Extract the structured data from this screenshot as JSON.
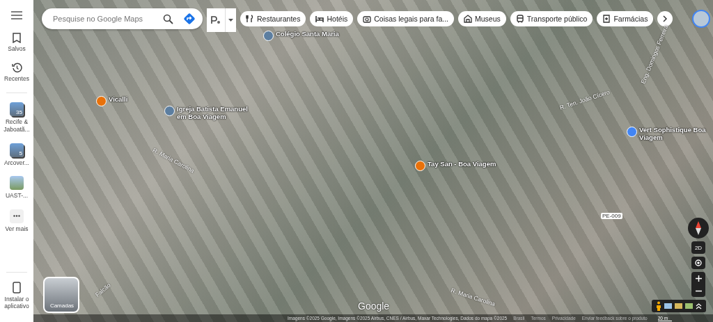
{
  "sidebar": {
    "items": [
      {
        "kind": "saved",
        "label": "Salvos"
      },
      {
        "kind": "recent",
        "label": "Recentes"
      },
      {
        "kind": "list",
        "label": "Recife & Jaboatã...",
        "count": "35"
      },
      {
        "kind": "list",
        "label": "Arcover...",
        "count": "5"
      },
      {
        "kind": "place",
        "label": "UAST-..."
      },
      {
        "kind": "more",
        "label": "Ver mais"
      }
    ],
    "install": "Instalar o aplicativo"
  },
  "search": {
    "placeholder": "Pesquise no Google Maps"
  },
  "chips": [
    {
      "kind": "restaurant",
      "label": "Restaurantes"
    },
    {
      "kind": "hotel",
      "label": "Hotéis"
    },
    {
      "kind": "camera",
      "label": "Coisas legais para fa..."
    },
    {
      "kind": "museum",
      "label": "Museus"
    },
    {
      "kind": "transit",
      "label": "Transporte público"
    },
    {
      "kind": "pharmacy",
      "label": "Farmácias"
    }
  ],
  "map_labels": [
    {
      "kind": "school",
      "text": "Colégio Santa Maria"
    },
    {
      "kind": "restaurant",
      "text": "Vicalli"
    },
    {
      "kind": "church",
      "text": "Igreja Batista Emanuel em Boa Viagem"
    },
    {
      "kind": "restaurant",
      "text": "Tay San - Boa Viagem"
    },
    {
      "kind": "shop",
      "text": "Vert Sophistique Boa Viagem"
    },
    {
      "kind": "street",
      "text": "R. Maria Carolina"
    },
    {
      "kind": "street",
      "text": "R. Ten. João Cícero"
    },
    {
      "kind": "street",
      "text": "Eng. Domingos Ferreira"
    },
    {
      "kind": "road",
      "text": "PE-009"
    },
    {
      "kind": "street",
      "text": "R. Maria Carolina"
    },
    {
      "kind": "street",
      "text": "Falcão"
    }
  ],
  "view_toggle": "2D",
  "layers": "Camadas",
  "logo": "Google",
  "footer": {
    "attribution": "Imagens ©2025 Google, Imagens ©2025 Airbus, CNES / Airbus, Maxar Technologies, Dados do mapa ©2025",
    "links": [
      "Brasil",
      "Termos",
      "Privacidade",
      "Enviar feedback sobre o produto"
    ],
    "scale": "20 m"
  }
}
